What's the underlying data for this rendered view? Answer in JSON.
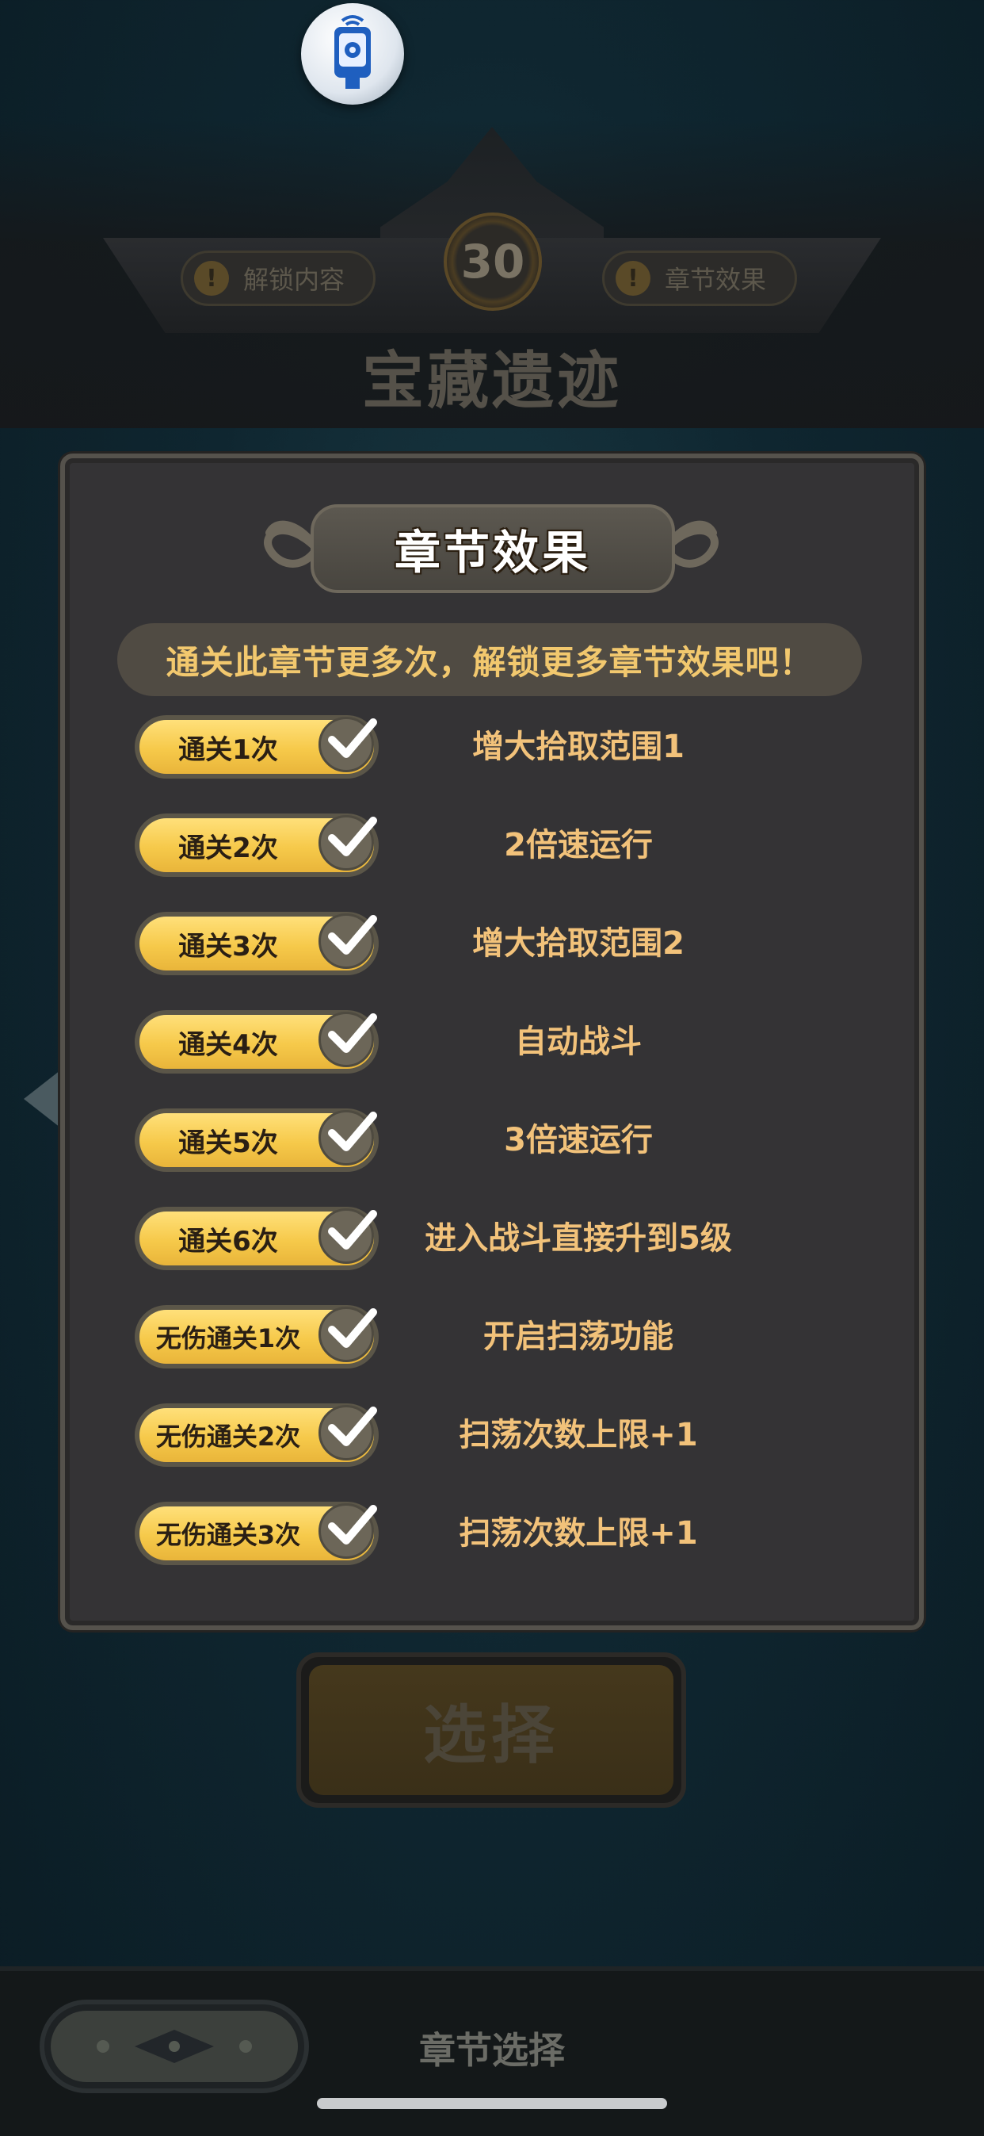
{
  "header": {
    "level": "30",
    "unlock_label": "解锁内容",
    "effect_label": "章节效果",
    "chapter_name": "宝藏遗迹",
    "warn_glyph": "!"
  },
  "panel": {
    "title": "章节效果",
    "hint": "通关此章节更多次，解锁更多章节效果吧！",
    "rows": [
      {
        "req": "通关1次",
        "effect": "增大拾取范围1",
        "checked": true
      },
      {
        "req": "通关2次",
        "effect": "2倍速运行",
        "checked": true
      },
      {
        "req": "通关3次",
        "effect": "增大拾取范围2",
        "checked": true
      },
      {
        "req": "通关4次",
        "effect": "自动战斗",
        "checked": true
      },
      {
        "req": "通关5次",
        "effect": "3倍速运行",
        "checked": true
      },
      {
        "req": "通关6次",
        "effect": "进入战斗直接升到5级",
        "checked": true
      },
      {
        "req": "无伤通关1次",
        "effect": "开启扫荡功能",
        "checked": true
      },
      {
        "req": "无伤通关2次",
        "effect": "扫荡次数上限+1",
        "checked": true
      },
      {
        "req": "无伤通关3次",
        "effect": "扫荡次数上限+1",
        "checked": true
      }
    ]
  },
  "select_button": {
    "label": "选择"
  },
  "bottom": {
    "label": "章节选择"
  },
  "colors": {
    "accent_gold": "#f6c94a",
    "effect_text": "#f2c27a",
    "panel_bg": "#343335"
  }
}
